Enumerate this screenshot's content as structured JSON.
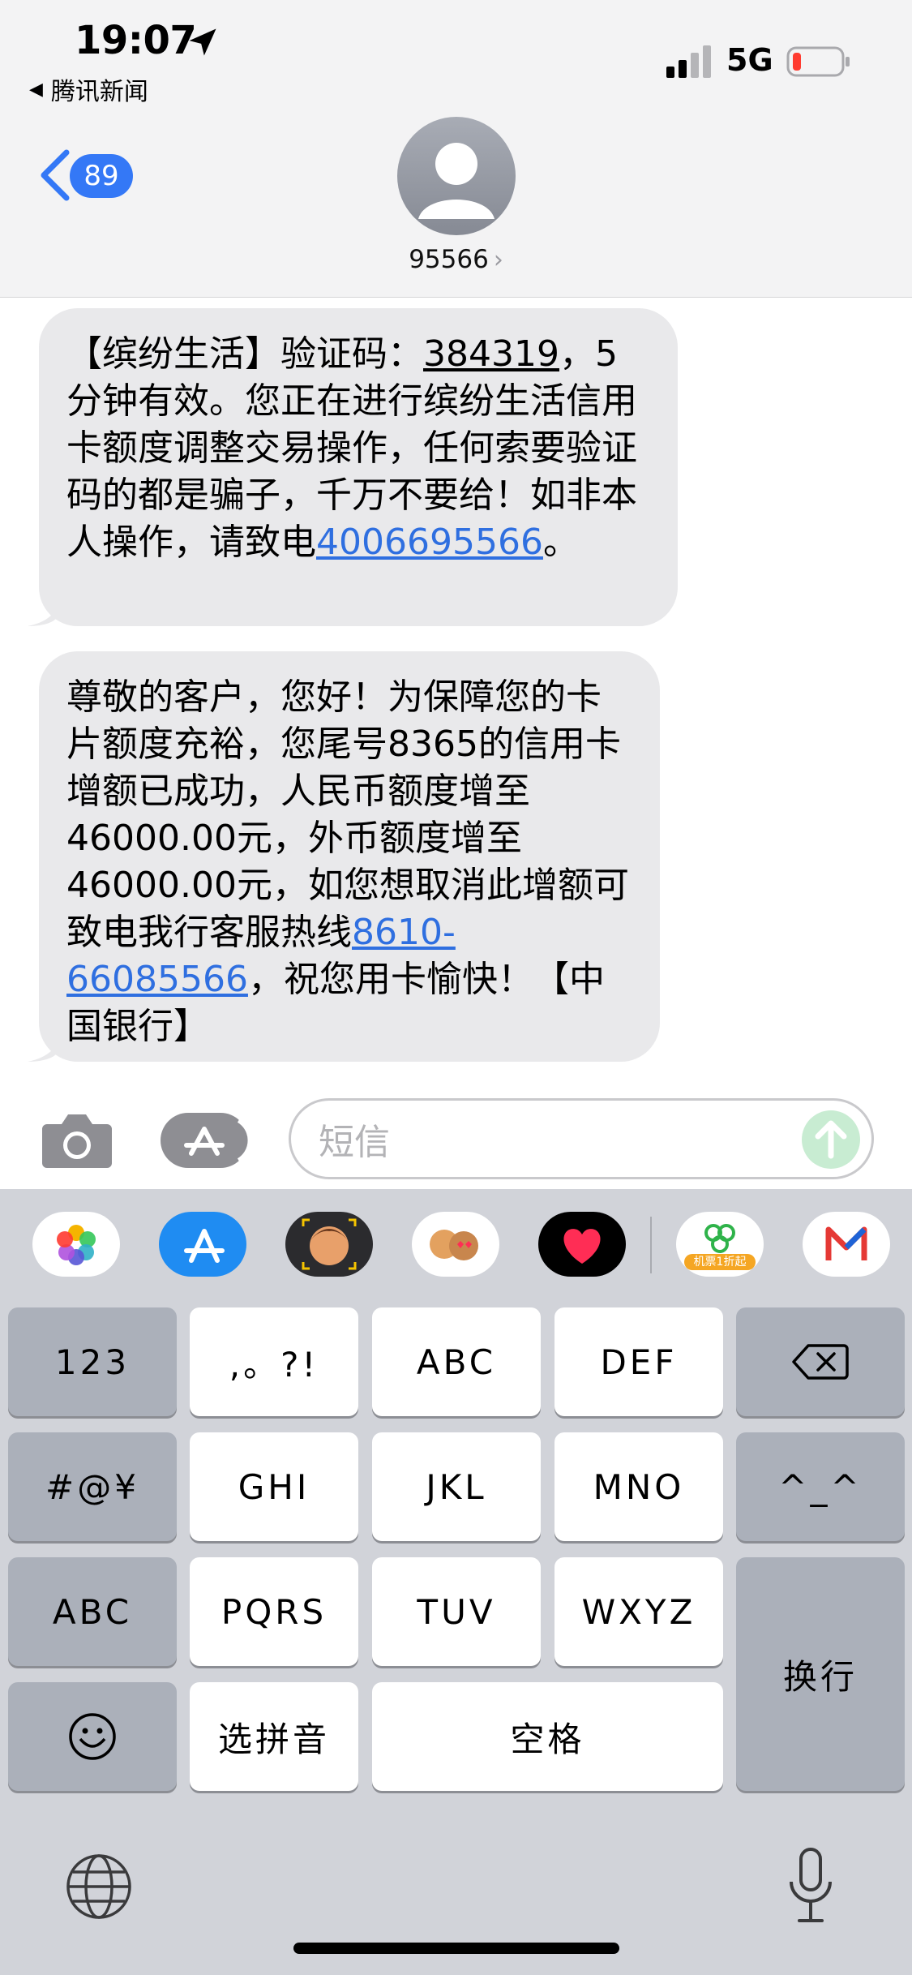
{
  "status_bar": {
    "time": "19:07",
    "back_app": "腾讯新闻",
    "network": "5G"
  },
  "header": {
    "unread_count": "89",
    "contact": "95566",
    "chevron": "›"
  },
  "messages": [
    {
      "segments": [
        {
          "text": "【缤纷生活】验证码：",
          "style": "normal"
        },
        {
          "text": "384319",
          "style": "code"
        },
        {
          "text": "，5分钟有效。您正在进行缤纷生活信用卡额度调整交易操作，任何索要验证码的都是骗子，千万不要给！如非本人操作，请致电",
          "style": "normal"
        },
        {
          "text": "4006695566",
          "style": "link"
        },
        {
          "text": "。",
          "style": "normal"
        }
      ]
    },
    {
      "segments": [
        {
          "text": "尊敬的客户，您好！为保障您的卡片额度充裕，您尾号8365的信用卡增额已成功，人民币额度增至46000.00元，外币额度增至46000.00元，如您想取消此增额可致电我行客服热线",
          "style": "normal"
        },
        {
          "text": "8610-66085566",
          "style": "link"
        },
        {
          "text": "，祝您用卡愉快！【中国银行】",
          "style": "normal"
        }
      ]
    }
  ],
  "input": {
    "placeholder": "短信"
  },
  "keyboard": {
    "rows": [
      [
        "123",
        ",。?!",
        "ABC",
        "DEF",
        ""
      ],
      [
        "#@¥",
        "GHI",
        "JKL",
        "MNO",
        "^_^"
      ],
      [
        "ABC",
        "PQRS",
        "TUV",
        "WXYZ"
      ],
      [
        "",
        "选拼音",
        "空格"
      ]
    ],
    "return_label": "换行",
    "app_strip_label": "机票1折起"
  },
  "colors": {
    "link": "#2f6fe0",
    "badge": "#3478f6",
    "bubble": "#e9e9eb",
    "keyboard_bg": "#d1d3d9"
  }
}
